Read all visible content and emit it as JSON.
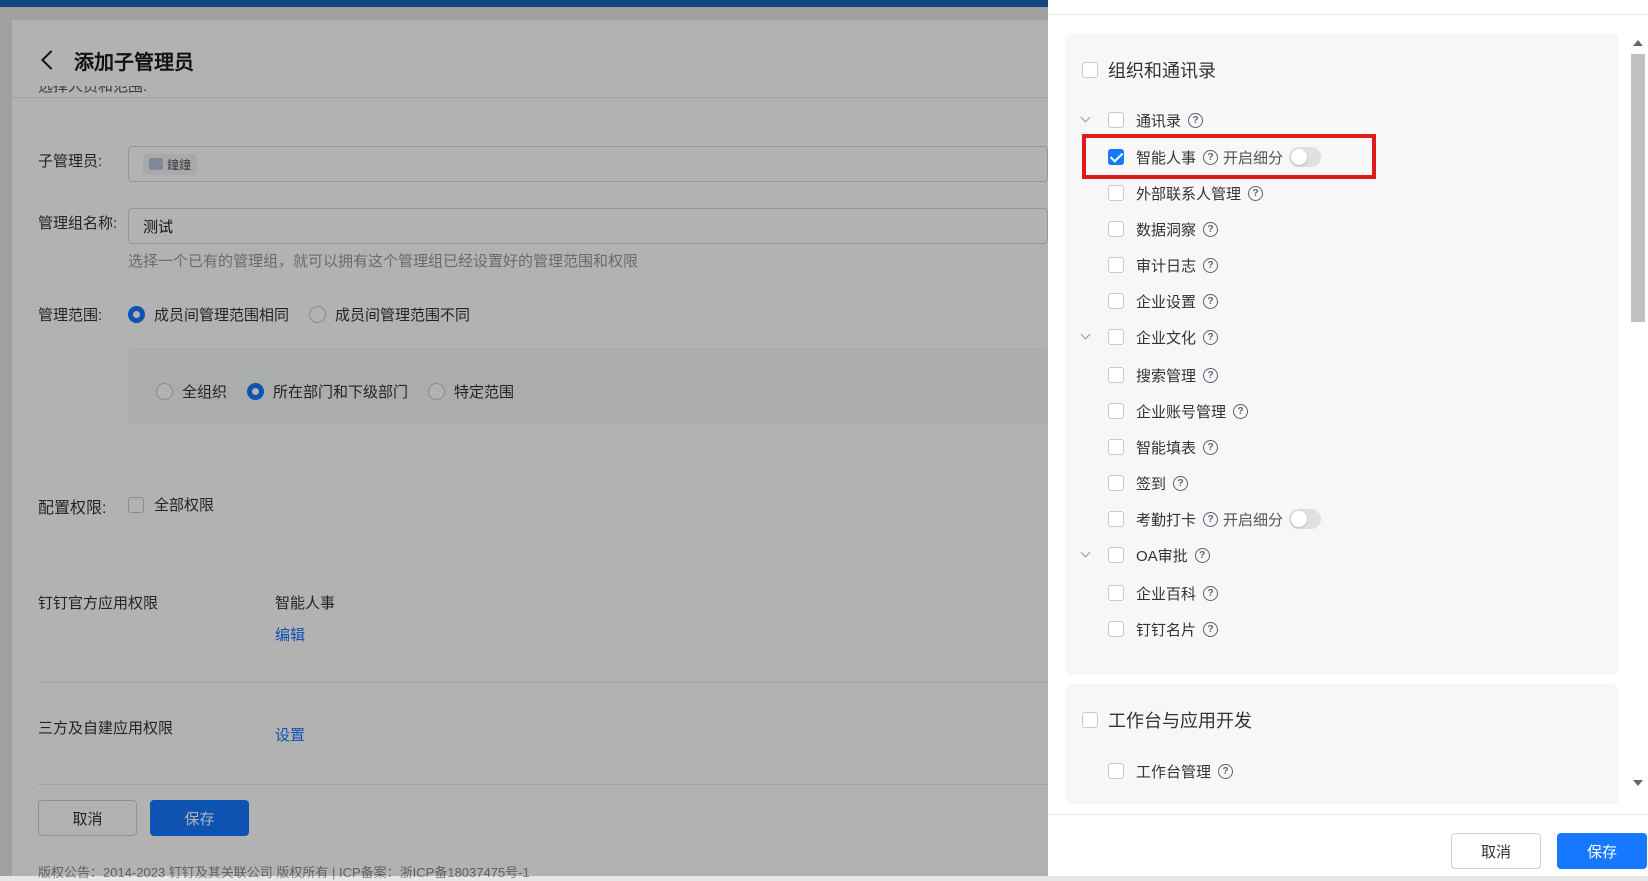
{
  "page": {
    "title": "添加子管理员",
    "cut_text": "选择人员和范围:",
    "sub_admin_label": "子管理员:",
    "sub_admin_chip": "鐘鐘",
    "group_name_label": "管理组名称:",
    "group_name_value": "测试",
    "group_hint": "选择一个已有的管理组，就可以拥有这个管理组已经设置好的管理范围和权限",
    "scope_label": "管理范围:",
    "scope_options": [
      "成员间管理范围相同",
      "成员间管理范围不同"
    ],
    "range_options": [
      "全组织",
      "所在部门和下级部门",
      "特定范围"
    ],
    "config_label": "配置权限:",
    "all_perms_label": "全部权限",
    "official_app_label": "钉钉官方应用权限",
    "official_app_value": "智能人事",
    "edit_link": "编辑",
    "third_party_label": "三方及自建应用权限",
    "settings_link": "设置",
    "cancel": "取消",
    "save": "保存",
    "footer": "版权公告：2014-2023 钉钉及其关联公司 版权所有 | ICP备案：浙ICP备18037475号-1"
  },
  "drawer": {
    "section1_title": "组织和通讯录",
    "items": [
      {
        "label": "通讯录"
      },
      {
        "label": "智能人事",
        "toggle_label": "开启细分"
      },
      {
        "label": "外部联系人管理"
      },
      {
        "label": "数据洞察"
      },
      {
        "label": "审计日志"
      },
      {
        "label": "企业设置"
      },
      {
        "label": "企业文化"
      },
      {
        "label": "搜索管理"
      },
      {
        "label": "企业账号管理"
      },
      {
        "label": "智能填表"
      },
      {
        "label": "签到"
      },
      {
        "label": "考勤打卡",
        "toggle_label": "开启细分"
      },
      {
        "label": "OA审批"
      },
      {
        "label": "企业百科"
      },
      {
        "label": "钉钉名片"
      }
    ],
    "section2_title": "工作台与应用开发",
    "section2_items": [
      {
        "label": "工作台管理"
      }
    ],
    "cancel": "取消",
    "save": "保存"
  },
  "colors": {
    "primary": "#1677ff",
    "highlight": "#e01b1b",
    "topbar": "#1565b8"
  }
}
